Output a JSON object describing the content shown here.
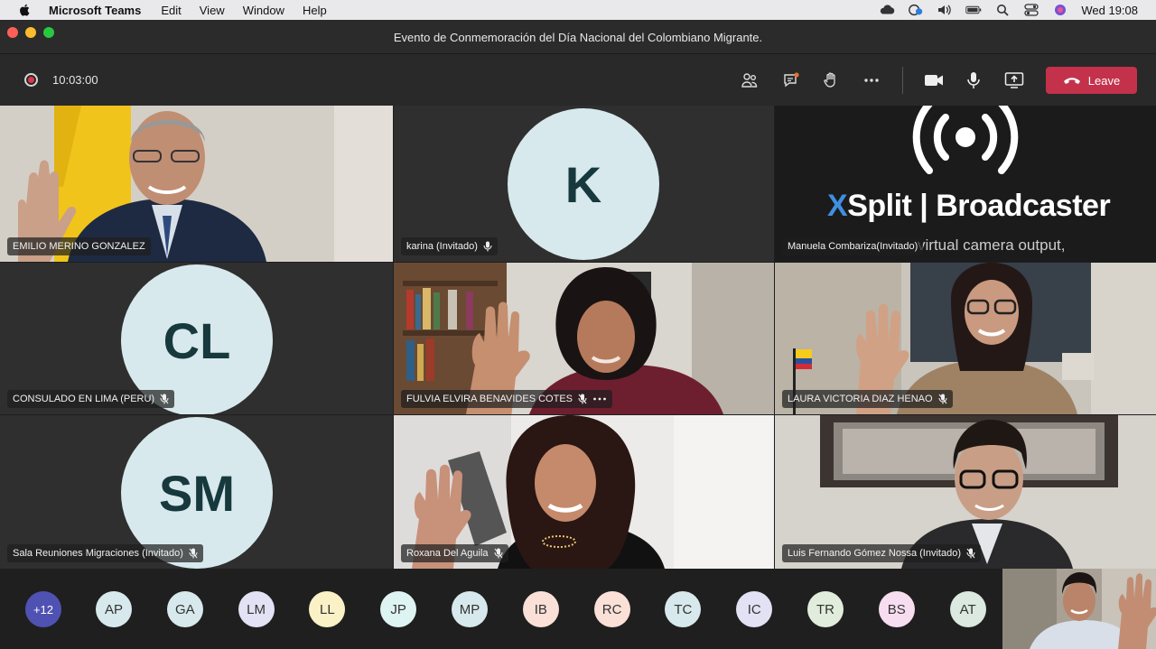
{
  "menubar": {
    "app_name": "Microsoft Teams",
    "items": [
      "Edit",
      "View",
      "Window",
      "Help"
    ],
    "clock": "Wed 19:08"
  },
  "window": {
    "title": "Evento de Conmemoración del Día Nacional del Colombiano Migrante."
  },
  "toolbar": {
    "timer": "10:03:00",
    "leave_label": "Leave",
    "leave_color": "#c4314b"
  },
  "tiles": [
    {
      "name": "EMILIO MERINO GONZALEZ",
      "type": "video"
    },
    {
      "name": "karina (Invitado)",
      "type": "avatar",
      "initials": "K",
      "mic": true
    },
    {
      "name": "Manuela Combariza(Invitado)",
      "type": "broadcast",
      "brand_x": "X",
      "brand_rest": "Split | Broadcaster",
      "caption": "virtual camera output,"
    },
    {
      "name": "CONSULADO EN LIMA (PERU)",
      "type": "avatar",
      "initials": "CL",
      "mic": true
    },
    {
      "name": "FULVIA ELVIRA BENAVIDES COTES",
      "type": "video",
      "mic": true,
      "more": true
    },
    {
      "name": "LAURA VICTORIA DIAZ HENAO",
      "type": "video",
      "mic": true
    },
    {
      "name": "Sala Reuniones Migraciones (Invitado)",
      "type": "avatar",
      "initials": "SM",
      "mic": true
    },
    {
      "name": "Roxana Del Aguila",
      "type": "video",
      "mic": true
    },
    {
      "name": "Luis Fernando Gómez Nossa (Invitado)",
      "type": "video",
      "mic": true
    }
  ],
  "participants": {
    "overflow": "+12",
    "chips": [
      {
        "initials": "AP",
        "color": "#d7e9ec"
      },
      {
        "initials": "GA",
        "color": "#d7e9ec"
      },
      {
        "initials": "LM",
        "color": "#e3e1f4"
      },
      {
        "initials": "LL",
        "color": "#fbf1c7"
      },
      {
        "initials": "JP",
        "color": "#def4f2"
      },
      {
        "initials": "MP",
        "color": "#d7e9ec"
      },
      {
        "initials": "IB",
        "color": "#fbe0d8"
      },
      {
        "initials": "RC",
        "color": "#fbe0d8"
      },
      {
        "initials": "TC",
        "color": "#d7e9ec"
      },
      {
        "initials": "IC",
        "color": "#e3e1f4"
      },
      {
        "initials": "TR",
        "color": "#e2ecdc"
      },
      {
        "initials": "BS",
        "color": "#f6def0"
      },
      {
        "initials": "AT",
        "color": "#dbe9e0"
      }
    ]
  }
}
